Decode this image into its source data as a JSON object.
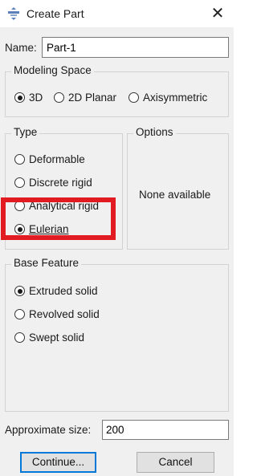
{
  "window": {
    "title": "Create Part",
    "close_glyph": "✕",
    "icon": "abaqus-part-icon"
  },
  "name": {
    "label": "Name:",
    "value": "Part-1"
  },
  "modeling_space": {
    "title": "Modeling Space",
    "options": [
      {
        "label": "3D",
        "checked": true
      },
      {
        "label": "2D Planar",
        "checked": false
      },
      {
        "label": "Axisymmetric",
        "checked": false
      }
    ]
  },
  "type": {
    "title": "Type",
    "options": [
      {
        "label": "Deformable",
        "checked": false
      },
      {
        "label": "Discrete rigid",
        "checked": false
      },
      {
        "label": "Analytical rigid",
        "checked": false
      },
      {
        "label": "Eulerian",
        "checked": true
      }
    ]
  },
  "options": {
    "title": "Options",
    "text": "None available"
  },
  "base_feature": {
    "title": "Base Feature",
    "options": [
      {
        "label": "Extruded solid",
        "checked": true
      },
      {
        "label": "Revolved solid",
        "checked": false
      },
      {
        "label": "Swept solid",
        "checked": false
      }
    ]
  },
  "approx_size": {
    "label": "Approximate size:",
    "value": "200"
  },
  "buttons": {
    "continue": "Continue...",
    "cancel": "Cancel"
  },
  "annotation": {
    "highlight_color": "#e21b23",
    "focus_color": "#0078d7"
  }
}
